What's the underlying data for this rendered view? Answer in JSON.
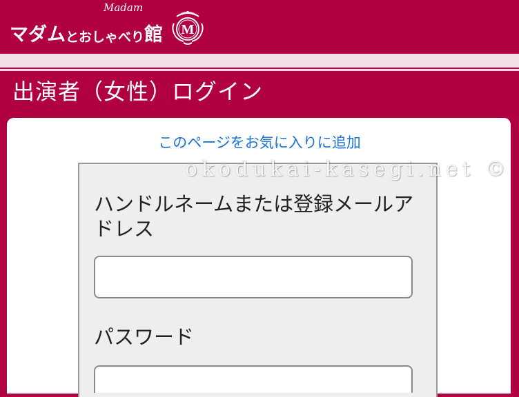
{
  "header": {
    "logo_main": "マダム",
    "logo_mid": "とおしゃべり",
    "logo_kan": "館",
    "logo_script": "Madam",
    "emblem_letter": "M"
  },
  "page": {
    "title": "出演者（女性）ログイン"
  },
  "favorite": {
    "label": "このページをお気に入りに追加"
  },
  "form": {
    "handle_label": "ハンドルネームまたは登録メールアドレス",
    "handle_value": "",
    "password_label": "パスワード",
    "password_value": ""
  },
  "watermark": {
    "text": "okodukai-kasegi.net ©"
  },
  "colors": {
    "brand": "#b1003f",
    "band": "#f4dfe6",
    "link": "#1a73d9",
    "form_bg": "#eeeeee"
  }
}
